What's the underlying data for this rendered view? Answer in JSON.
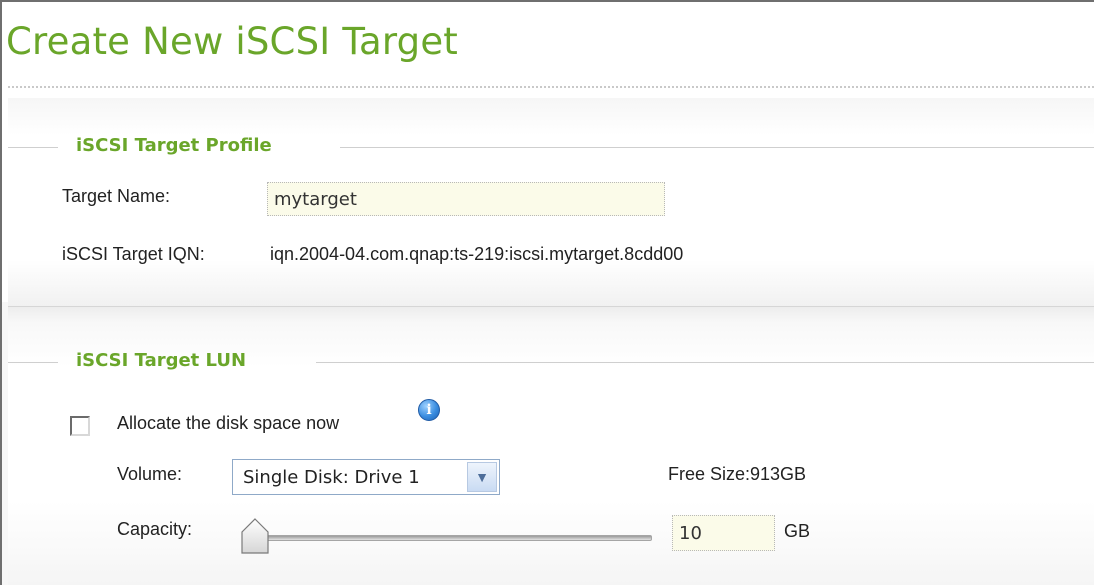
{
  "title": "Create New iSCSI Target",
  "profile": {
    "legend": "iSCSI Target Profile",
    "target_name_label": "Target Name:",
    "target_name_value": "mytarget",
    "iqn_label": "iSCSI Target IQN:",
    "iqn_value": "iqn.2004-04.com.qnap:ts-219:iscsi.mytarget.8cdd00"
  },
  "lun": {
    "legend": "iSCSI Target LUN",
    "allocate_label": "Allocate the disk space now",
    "allocate_checked": false,
    "info_icon": "info-icon",
    "volume_label": "Volume:",
    "volume_selected": "Single Disk: Drive 1",
    "free_size": "Free Size:913GB",
    "capacity_label": "Capacity:",
    "capacity_value": "10",
    "capacity_unit": "GB",
    "capacity_slider_fraction": 0.0
  },
  "colors": {
    "accent_green": "#6aa62a",
    "input_bg": "#fbfbe9"
  }
}
